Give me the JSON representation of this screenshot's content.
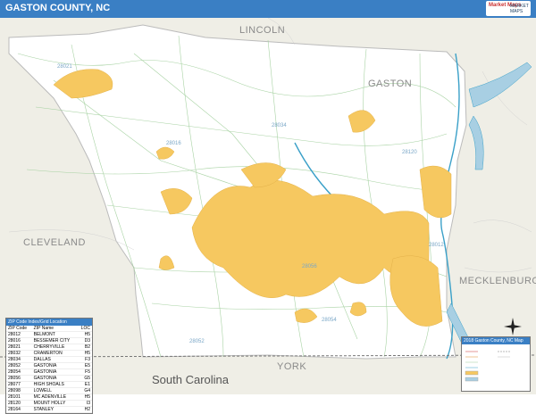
{
  "title": "GASTON COUNTY, NC",
  "logo": {
    "line1": "Market Maps",
    "line2": "MARKET MAPS"
  },
  "counties": {
    "lincoln": "LINCOLN",
    "gaston": "GASTON",
    "cleveland": "CLEVELAND",
    "mecklenburg": "MECKLENBURG",
    "york": "YORK"
  },
  "state_label": "South Carolina",
  "zip_labels": [
    "28021",
    "28016",
    "28034",
    "28120",
    "28012",
    "28056",
    "28052",
    "28054"
  ],
  "index": {
    "title": "ZIP Code Index/Grid Location",
    "headers": [
      "ZIP Code",
      "ZIP Name",
      "LOC"
    ],
    "rows": [
      [
        "28012",
        "BELMONT",
        "H5"
      ],
      [
        "28016",
        "BESSEMER CITY",
        "D3"
      ],
      [
        "28021",
        "CHERRYVILLE",
        "B2"
      ],
      [
        "28032",
        "CRAMERTON",
        "H5"
      ],
      [
        "28034",
        "DALLAS",
        "F3"
      ],
      [
        "28052",
        "GASTONIA",
        "E5"
      ],
      [
        "28054",
        "GASTONIA",
        "F5"
      ],
      [
        "28056",
        "GASTONIA",
        "G5"
      ],
      [
        "28077",
        "HIGH SHOALS",
        "E1"
      ],
      [
        "28098",
        "LOWELL",
        "G4"
      ],
      [
        "28101",
        "MC ADENVILLE",
        "H5"
      ],
      [
        "28120",
        "MOUNT HOLLY",
        "I3"
      ],
      [
        "28164",
        "STANLEY",
        "H2"
      ]
    ]
  },
  "legend": {
    "title": "2018 Gaston County, NC Map"
  },
  "colors": {
    "title_bar": "#3a7fc4",
    "urban": "#f6c860",
    "water": "#3aa0c8",
    "land": "#efeee6",
    "county": "#ffffff"
  }
}
